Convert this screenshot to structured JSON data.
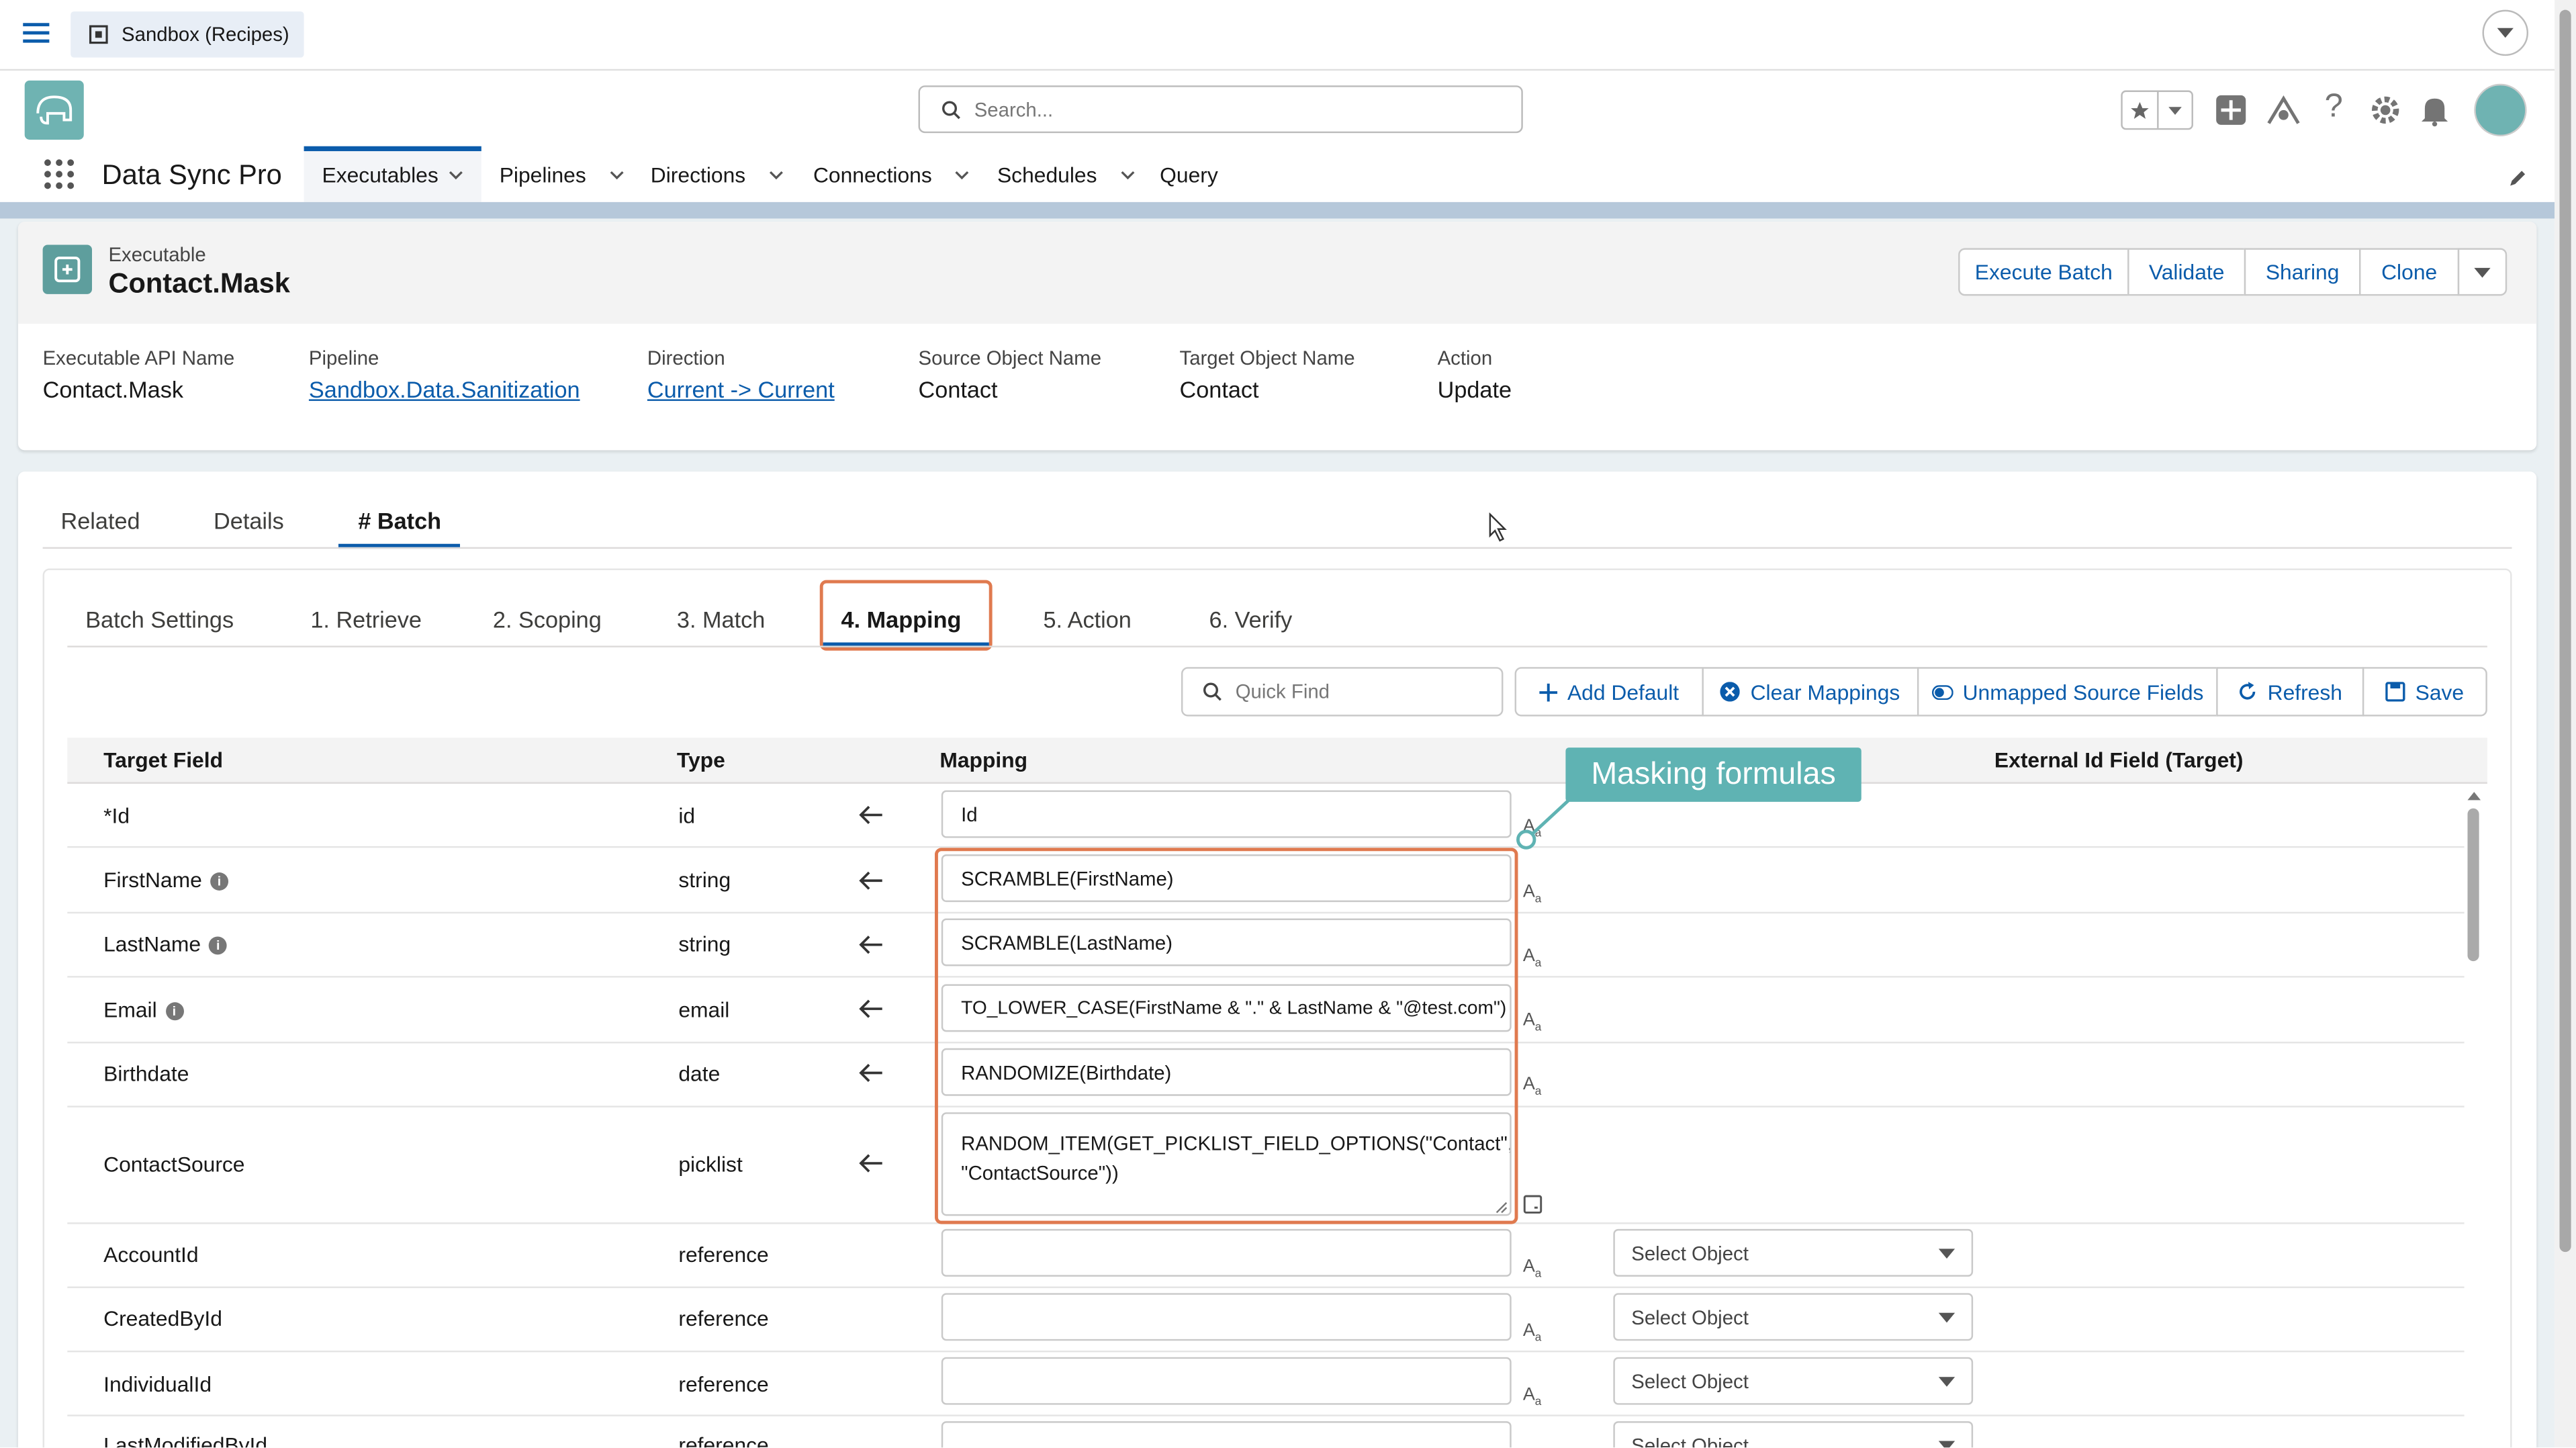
{
  "header": {
    "org_tab": "Sandbox (Recipes)",
    "search_placeholder": "Search...",
    "app_name": "Data Sync Pro",
    "nav": [
      {
        "label": "Executables"
      },
      {
        "label": "Pipelines"
      },
      {
        "label": "Directions"
      },
      {
        "label": "Connections"
      },
      {
        "label": "Schedules"
      },
      {
        "label": "Query"
      }
    ]
  },
  "record": {
    "object_label": "Executable",
    "title": "Contact.Mask",
    "actions": [
      "Execute Batch",
      "Validate",
      "Sharing",
      "Clone"
    ],
    "fields": [
      {
        "label": "Executable API Name",
        "value": "Contact.Mask"
      },
      {
        "label": "Pipeline",
        "value": "Sandbox.Data.Sanitization"
      },
      {
        "label": "Direction",
        "value": "Current -> Current"
      },
      {
        "label": "Source Object Name",
        "value": "Contact"
      },
      {
        "label": "Target Object Name",
        "value": "Contact"
      },
      {
        "label": "Action",
        "value": "Update"
      }
    ]
  },
  "tabs": {
    "main": [
      "Related",
      "Details",
      "# Batch"
    ],
    "batch": [
      "Batch Settings",
      "1. Retrieve",
      "2. Scoping",
      "3. Match",
      "4. Mapping",
      "5. Action",
      "6. Verify"
    ]
  },
  "toolbar": {
    "quick_find_placeholder": "Quick Find",
    "add_default": "Add Default",
    "clear_mappings": "Clear Mappings",
    "unmapped_source_fields": "Unmapped Source Fields",
    "refresh": "Refresh",
    "save": "Save"
  },
  "table": {
    "headers": {
      "target_field": "Target Field",
      "type": "Type",
      "mapping": "Mapping",
      "external_id": "External Id Field (Target)"
    },
    "rows": [
      {
        "field": "*Id",
        "type": "id",
        "mapping": "Id"
      },
      {
        "field": "FirstName",
        "type": "string",
        "mapping": "SCRAMBLE(FirstName)"
      },
      {
        "field": "LastName",
        "type": "string",
        "mapping": "SCRAMBLE(LastName)"
      },
      {
        "field": "Email",
        "type": "email",
        "mapping": "TO_LOWER_CASE(FirstName & \".\" & LastName & \"@test.com\")"
      },
      {
        "field": "Birthdate",
        "type": "date",
        "mapping": "RANDOMIZE(Birthdate)"
      },
      {
        "field": "ContactSource",
        "type": "picklist",
        "mapping": "RANDOM_ITEM(GET_PICKLIST_FIELD_OPTIONS(\"Contact\", \"ContactSource\"))"
      },
      {
        "field": "AccountId",
        "type": "reference",
        "mapping": "",
        "select": "Select Object"
      },
      {
        "field": "CreatedById",
        "type": "reference",
        "mapping": "",
        "select": "Select Object"
      },
      {
        "field": "IndividualId",
        "type": "reference",
        "mapping": "",
        "select": "Select Object"
      },
      {
        "field": "LastModifiedById",
        "type": "reference",
        "mapping": "",
        "select": "Select Object"
      }
    ]
  },
  "annotation": {
    "label": "Masking formulas"
  },
  "colors": {
    "brand_blue": "#0b5cab",
    "highlight_orange": "#e07a4f",
    "callout_teal": "#5fb3b3"
  }
}
